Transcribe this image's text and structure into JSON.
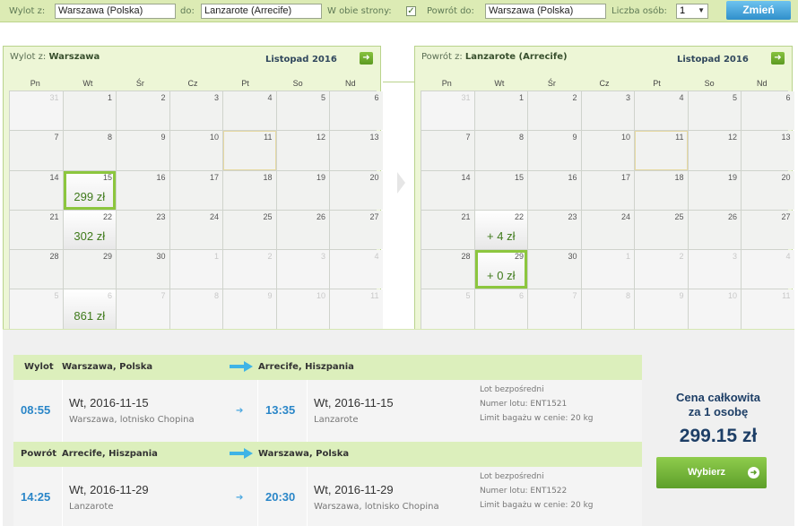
{
  "search": {
    "wylot_label": "Wylot z:",
    "wylot_value": "Warszawa (Polska)",
    "do_label": "do:",
    "do_value": "Lanzarote (Arrecife)",
    "obie_label": "W obie strony:",
    "powrot_label": "Powrót do:",
    "powrot_value": "Warszawa (Polska)",
    "osob_label": "Liczba osób:",
    "osob_value": "1",
    "zmien_label": "Zmień"
  },
  "cal_out": {
    "title_prefix": "Wylot z:",
    "title_city": "Warszawa",
    "month": "Listopad 2016",
    "weekdays": [
      "Pn",
      "Wt",
      "Śr",
      "Cz",
      "Pt",
      "So",
      "Nd"
    ],
    "days": [
      {
        "n": "31",
        "o": 1
      },
      {
        "n": "1"
      },
      {
        "n": "2"
      },
      {
        "n": "3"
      },
      {
        "n": "4"
      },
      {
        "n": "5"
      },
      {
        "n": "6"
      },
      {
        "n": "7"
      },
      {
        "n": "8"
      },
      {
        "n": "9"
      },
      {
        "n": "10"
      },
      {
        "n": "11",
        "today": 1
      },
      {
        "n": "12"
      },
      {
        "n": "13"
      },
      {
        "n": "14"
      },
      {
        "n": "15",
        "p": "299 zł",
        "sel": 1
      },
      {
        "n": "16"
      },
      {
        "n": "17"
      },
      {
        "n": "18"
      },
      {
        "n": "19"
      },
      {
        "n": "20"
      },
      {
        "n": "21"
      },
      {
        "n": "22",
        "p": "302 zł"
      },
      {
        "n": "23"
      },
      {
        "n": "24"
      },
      {
        "n": "25"
      },
      {
        "n": "26"
      },
      {
        "n": "27"
      },
      {
        "n": "28"
      },
      {
        "n": "29"
      },
      {
        "n": "30"
      },
      {
        "n": "1",
        "o": 1
      },
      {
        "n": "2",
        "o": 1
      },
      {
        "n": "3",
        "o": 1
      },
      {
        "n": "4",
        "o": 1
      },
      {
        "n": "5",
        "o": 1
      },
      {
        "n": "6",
        "o": 1,
        "p": "861 zł"
      },
      {
        "n": "7",
        "o": 1
      },
      {
        "n": "8",
        "o": 1
      },
      {
        "n": "9",
        "o": 1
      },
      {
        "n": "10",
        "o": 1
      },
      {
        "n": "11",
        "o": 1
      }
    ]
  },
  "cal_ret": {
    "title_prefix": "Powrót z:",
    "title_city": "Lanzarote (Arrecife)",
    "month": "Listopad 2016",
    "weekdays": [
      "Pn",
      "Wt",
      "Śr",
      "Cz",
      "Pt",
      "So",
      "Nd"
    ],
    "days": [
      {
        "n": "31",
        "o": 1
      },
      {
        "n": "1"
      },
      {
        "n": "2"
      },
      {
        "n": "3"
      },
      {
        "n": "4"
      },
      {
        "n": "5"
      },
      {
        "n": "6"
      },
      {
        "n": "7"
      },
      {
        "n": "8"
      },
      {
        "n": "9"
      },
      {
        "n": "10"
      },
      {
        "n": "11",
        "today": 1
      },
      {
        "n": "12"
      },
      {
        "n": "13"
      },
      {
        "n": "14"
      },
      {
        "n": "15"
      },
      {
        "n": "16"
      },
      {
        "n": "17"
      },
      {
        "n": "18"
      },
      {
        "n": "19"
      },
      {
        "n": "20"
      },
      {
        "n": "21"
      },
      {
        "n": "22",
        "p": "+ 4 zł"
      },
      {
        "n": "23"
      },
      {
        "n": "24"
      },
      {
        "n": "25"
      },
      {
        "n": "26"
      },
      {
        "n": "27"
      },
      {
        "n": "28"
      },
      {
        "n": "29",
        "p": "+ 0 zł",
        "sel": 1
      },
      {
        "n": "30"
      },
      {
        "n": "1",
        "o": 1
      },
      {
        "n": "2",
        "o": 1
      },
      {
        "n": "3",
        "o": 1
      },
      {
        "n": "4",
        "o": 1
      },
      {
        "n": "5",
        "o": 1
      },
      {
        "n": "6",
        "o": 1
      },
      {
        "n": "7",
        "o": 1
      },
      {
        "n": "8",
        "o": 1
      },
      {
        "n": "9",
        "o": 1
      },
      {
        "n": "10",
        "o": 1
      },
      {
        "n": "11",
        "o": 1
      }
    ]
  },
  "outbound": {
    "label": "Wylot",
    "from": "Warszawa, Polska",
    "to": "Arrecife, Hiszpania",
    "dep_time": "08:55",
    "dep_date": "Wt, 2016-11-15",
    "dep_airport": "Warszawa, lotnisko Chopina",
    "arr_time": "13:35",
    "arr_date": "Wt, 2016-11-15",
    "arr_airport": "Lanzarote",
    "info1": "Lot bezpośredni",
    "info2": "Numer lotu: ENT1521",
    "info3": "Limit bagażu w cenie: 20 kg"
  },
  "inbound": {
    "label": "Powrót",
    "from": "Arrecife, Hiszpania",
    "to": "Warszawa, Polska",
    "dep_time": "14:25",
    "dep_date": "Wt, 2016-11-29",
    "dep_airport": "Lanzarote",
    "arr_time": "20:30",
    "arr_date": "Wt, 2016-11-29",
    "arr_airport": "Warszawa, lotnisko Chopina",
    "info1": "Lot bezpośredni",
    "info2": "Numer lotu: ENT1522",
    "info3": "Limit bagażu w cenie: 20 kg"
  },
  "total": {
    "line1": "Cena całkowita",
    "line2": "za 1 osobę",
    "amount": "299.15 zł",
    "button": "Wybierz"
  }
}
